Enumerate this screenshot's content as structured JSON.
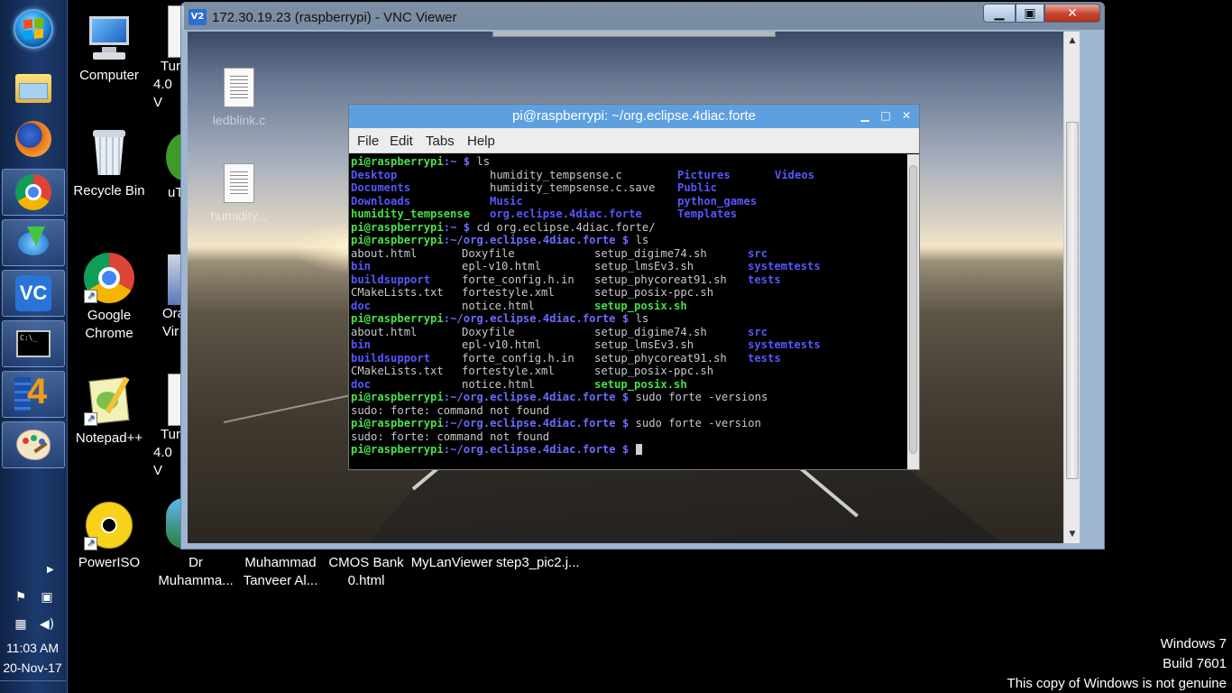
{
  "taskbar": {
    "pinned": [
      {
        "name": "start",
        "icon": "windows-orb-icon"
      },
      {
        "name": "explorer",
        "icon": "folder-icon"
      },
      {
        "name": "firefox",
        "icon": "firefox-icon"
      },
      {
        "name": "chrome",
        "icon": "chrome-icon"
      },
      {
        "name": "uget",
        "icon": "download-manager-icon"
      },
      {
        "name": "vnc",
        "icon": "vnc-viewer-icon",
        "label": "VC"
      },
      {
        "name": "cmd",
        "icon": "command-prompt-icon",
        "label": "C:\\_"
      },
      {
        "name": "4diac",
        "icon": "4diac-icon",
        "label": "4"
      },
      {
        "name": "paint",
        "icon": "paint-icon"
      }
    ],
    "clock": {
      "time": "11:03 AM",
      "date": "20-Nov-17"
    }
  },
  "desktop_icons": [
    {
      "label": "Computer",
      "icon": "computer-icon"
    },
    {
      "label": "Recycle Bin",
      "icon": "recycle-bin-icon"
    },
    {
      "label": "Google Chrome",
      "icon": "chrome-icon"
    },
    {
      "label": "Notepad++",
      "icon": "notepadpp-icon"
    },
    {
      "label": "PowerISO",
      "icon": "poweriso-icon"
    },
    {
      "label_top": "Tur",
      "label_bottom": "4.0 V"
    },
    {
      "label": "uT"
    },
    {
      "label_top": "Ora",
      "label_bottom": "Vir"
    },
    {
      "label_top": "Tur",
      "label_bottom": "4.0 V"
    }
  ],
  "bottom_labels": [
    {
      "line1": "Dr",
      "line2": "Muhamma..."
    },
    {
      "line1": "Muhammad",
      "line2": "Tanveer Al..."
    },
    {
      "line1": "CMOS Bank",
      "line2": "0.html"
    },
    {
      "line1": "MyLanViewer",
      "line2": ""
    },
    {
      "line1": "step3_pic2.j...",
      "line2": ""
    }
  ],
  "vnc": {
    "title": "172.30.19.23 (raspberrypi) - VNC Viewer",
    "logo": "V2",
    "remote_icons": [
      {
        "label": "ledblink.c"
      },
      {
        "label": "humidity..."
      }
    ]
  },
  "terminal": {
    "title": "pi@raspberrypi: ~/org.eclipse.4diac.forte",
    "menu": [
      "File",
      "Edit",
      "Tabs",
      "Help"
    ],
    "prompt_home": "pi@raspberrypi",
    "sep_home": ":~ $ ",
    "prompt_forte": "pi@raspberrypi",
    "path_forte": ":~/org.eclipse.4diac.forte $ ",
    "cmd1": "ls",
    "ls_home": [
      [
        "Desktop",
        "humidity_tempsense.c",
        "Pictures",
        "Videos"
      ],
      [
        "Documents",
        "humidity_tempsense.c.save",
        "Public",
        ""
      ],
      [
        "Downloads",
        "Music",
        "python_games",
        ""
      ],
      [
        "humidity_tempsense",
        "org.eclipse.4diac.forte",
        "Templates",
        ""
      ]
    ],
    "cmd2": "cd org.eclipse.4diac.forte/",
    "cmd3": "ls",
    "ls_forte": [
      [
        "about.html",
        "Doxyfile",
        "setup_digime74.sh",
        "src"
      ],
      [
        "bin",
        "epl-v10.html",
        "setup_lmsEv3.sh",
        "systemtests"
      ],
      [
        "buildsupport",
        "forte_config.h.in",
        "setup_phycoreat91.sh",
        "tests"
      ],
      [
        "CMakeLists.txt",
        "fortestyle.xml",
        "setup_posix-ppc.sh",
        ""
      ],
      [
        "doc",
        "notice.html",
        "setup_posix.sh",
        ""
      ]
    ],
    "cmd4": "ls",
    "cmd5": "sudo forte -versions",
    "err1": "sudo: forte: command not found",
    "cmd6": "sudo forte -version",
    "err2": "sudo: forte: command not found"
  },
  "watermark": {
    "line1": "Windows 7",
    "line2": "Build 7601",
    "line3": "This copy of Windows is not genuine"
  }
}
